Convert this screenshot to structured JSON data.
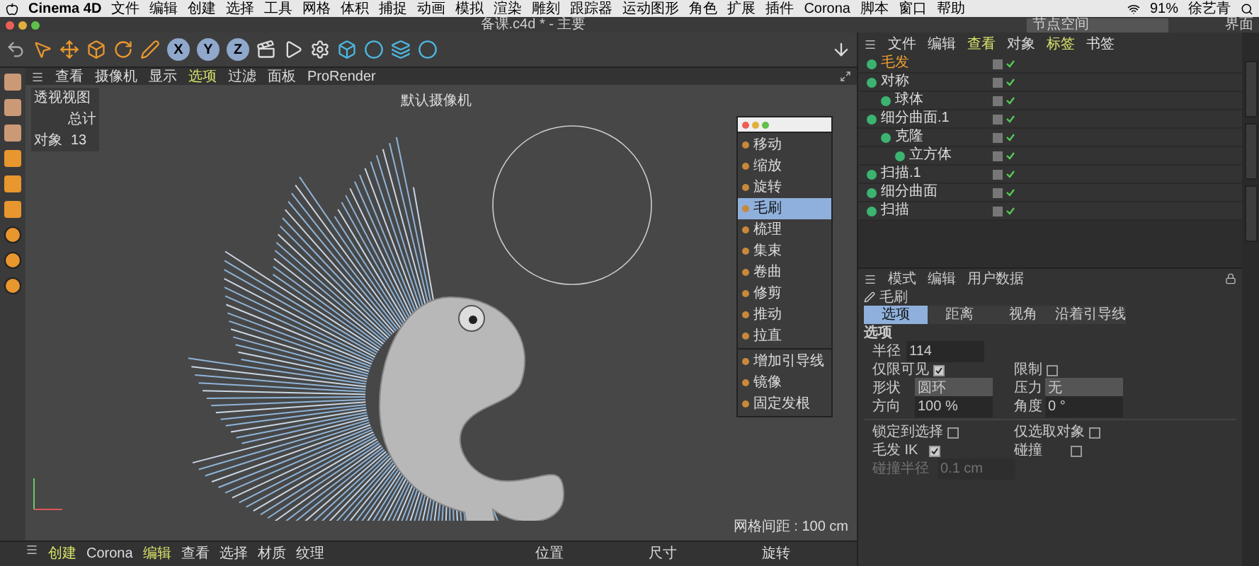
{
  "mac_menu": {
    "app": "Cinema 4D",
    "items": [
      "文件",
      "编辑",
      "创建",
      "选择",
      "工具",
      "网格",
      "体积",
      "捕捉",
      "动画",
      "模拟",
      "渲染",
      "雕刻",
      "跟踪器",
      "运动图形",
      "角色",
      "扩展",
      "插件",
      "Corona",
      "脚本",
      "窗口",
      "帮助"
    ],
    "battery": "91%",
    "user": "徐艺青"
  },
  "window": {
    "title": "备课.c4d * - 主要",
    "layout_field": "节点空间",
    "layout_button": "界面"
  },
  "toolbar": {
    "axes": [
      {
        "label": "X",
        "on": true
      },
      {
        "label": "Y",
        "on": true
      },
      {
        "label": "Z",
        "on": true
      }
    ]
  },
  "viewport": {
    "menu": [
      {
        "label": "查看",
        "selected": false
      },
      {
        "label": "摄像机",
        "selected": false
      },
      {
        "label": "显示",
        "selected": false
      },
      {
        "label": "选项",
        "selected": true
      },
      {
        "label": "过滤",
        "selected": false
      },
      {
        "label": "面板",
        "selected": false
      },
      {
        "label": "ProRender",
        "selected": false
      }
    ],
    "view_name": "透视视图",
    "stats_header": "总计",
    "stats_label": "对象",
    "stats_value": "13",
    "camera": "默认摄像机",
    "grid": "网格间距 : 100 cm"
  },
  "brush_menu": {
    "groups": [
      [
        {
          "label": "移动",
          "selected": false
        },
        {
          "label": "缩放",
          "selected": false
        },
        {
          "label": "旋转",
          "selected": false
        },
        {
          "label": "毛刷",
          "selected": true
        },
        {
          "label": "梳理",
          "selected": false
        },
        {
          "label": "集束",
          "selected": false
        },
        {
          "label": "卷曲",
          "selected": false
        },
        {
          "label": "修剪",
          "selected": false
        },
        {
          "label": "推动",
          "selected": false
        },
        {
          "label": "拉直",
          "selected": false
        }
      ],
      [
        {
          "label": "增加引导线",
          "selected": false
        },
        {
          "label": "镜像",
          "selected": false
        },
        {
          "label": "固定发根",
          "selected": false
        }
      ]
    ]
  },
  "bottom_bar": {
    "menu": [
      {
        "label": "创建",
        "selected": true
      },
      {
        "label": "Corona",
        "selected": false
      },
      {
        "label": "编辑",
        "selected": true
      },
      {
        "label": "查看",
        "selected": false
      },
      {
        "label": "选择",
        "selected": false
      },
      {
        "label": "材质",
        "selected": false
      },
      {
        "label": "纹理",
        "selected": false
      }
    ],
    "columns": [
      "位置",
      "尺寸",
      "旋转"
    ]
  },
  "object_manager": {
    "menu": [
      {
        "label": "文件",
        "selected": false
      },
      {
        "label": "编辑",
        "selected": false
      },
      {
        "label": "查看",
        "selected": true
      },
      {
        "label": "对象",
        "selected": false
      },
      {
        "label": "标签",
        "selected": true
      },
      {
        "label": "书签",
        "selected": false
      }
    ],
    "objects": [
      {
        "name": "毛发",
        "selected": true
      },
      {
        "name": "对称",
        "selected": false,
        "children": [
          {
            "name": "球体",
            "selected": false
          }
        ]
      },
      {
        "name": "细分曲面.1",
        "selected": false,
        "children": [
          {
            "name": "克隆",
            "selected": false,
            "children": [
              {
                "name": "立方体",
                "selected": false
              }
            ]
          }
        ]
      },
      {
        "name": "扫描.1",
        "selected": false
      },
      {
        "name": "细分曲面",
        "selected": false
      },
      {
        "name": "扫描",
        "selected": false
      }
    ]
  },
  "attributes": {
    "menu": [
      "模式",
      "编辑",
      "用户数据"
    ],
    "object": "毛刷",
    "tabs": [
      {
        "label": "选项",
        "selected": true
      },
      {
        "label": "距离",
        "selected": false
      },
      {
        "label": "视角",
        "selected": false
      },
      {
        "label": "沿着引导线",
        "selected": false
      }
    ],
    "section": "选项",
    "radius": {
      "label": "半径",
      "value": "114"
    },
    "visible_only": {
      "label": "仅限可见",
      "checked": true
    },
    "limit": {
      "label": "限制",
      "checked": false
    },
    "shape": {
      "label": "形状",
      "value": "圆环"
    },
    "pressure": {
      "label": "压力",
      "value": "无"
    },
    "direction": {
      "label": "方向",
      "value": "100 %"
    },
    "angle": {
      "label": "角度",
      "value": "0 °"
    },
    "lock_selection": {
      "label": "锁定到选择",
      "checked": false
    },
    "selected_only": {
      "label": "仅选取对象",
      "checked": false
    },
    "hair_ik": {
      "label": "毛发 IK",
      "checked": true
    },
    "collision": {
      "label": "碰撞",
      "checked": false
    },
    "collision_radius": {
      "label": "碰撞半径",
      "value": "0.1 cm",
      "disabled": true
    }
  }
}
